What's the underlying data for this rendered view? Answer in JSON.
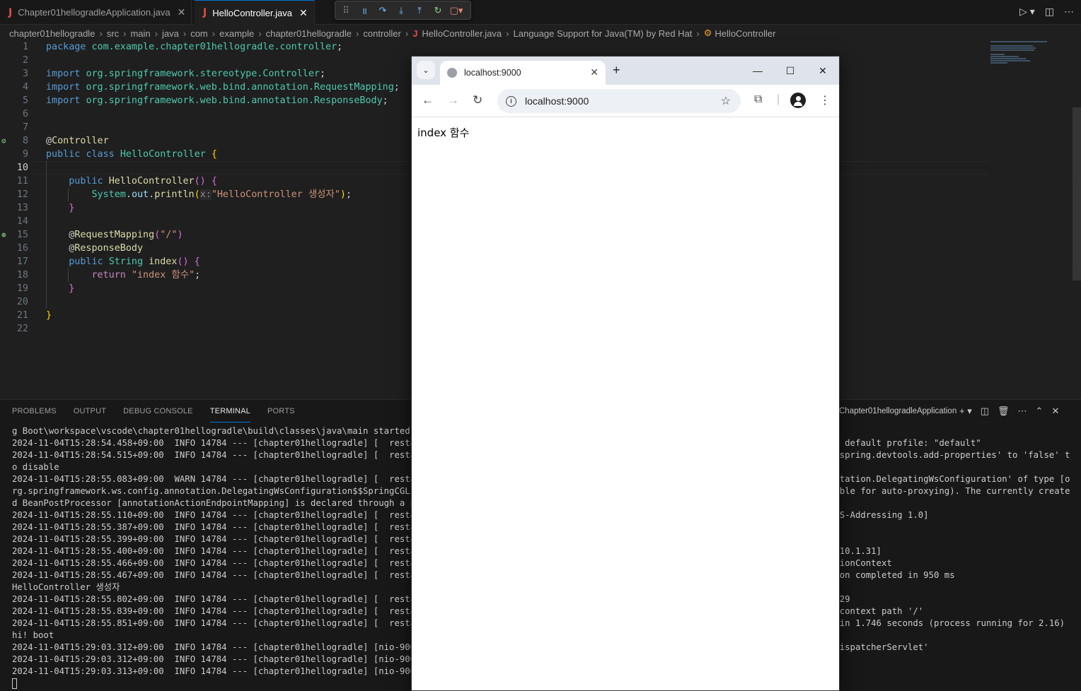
{
  "tabs": [
    {
      "label": "Chapter01hellogradleApplication.java",
      "active": false
    },
    {
      "label": "HelloController.java",
      "active": true
    }
  ],
  "breadcrumb": [
    "chapter01hellogradle",
    "src",
    "main",
    "java",
    "com",
    "example",
    "chapter01hellogradle",
    "controller",
    "HelloController.java",
    "Language Support for Java(TM) by Red Hat",
    "HelloController"
  ],
  "editor": {
    "current_line": 10,
    "line_numbers": [
      "1",
      "2",
      "3",
      "4",
      "5",
      "6",
      "7",
      "8",
      "9",
      "10",
      "11",
      "12",
      "13",
      "14",
      "15",
      "16",
      "17",
      "18",
      "19",
      "20",
      "21",
      "22"
    ],
    "tokens": {
      "package_kw": "package",
      "package_name": "com.example.chapter01hellogradle.controller",
      "import_kw": "import",
      "import1": "org.springframework.stereotype.Controller",
      "import2": "org.springframework.web.bind.annotation.RequestMapping",
      "import3": "org.springframework.web.bind.annotation.ResponseBody",
      "ann_controller": "Controller",
      "public_kw": "public",
      "class_kw": "class",
      "class_name": "HelloController",
      "ctor_name": "HelloController",
      "sysout_system": "System",
      "sysout_out": "out",
      "sysout_println": "println",
      "hint_x": "x:",
      "ctor_string": "\"HelloController 생성자\"",
      "ann_requestmapping": "RequestMapping",
      "ann_rm_arg": "\"/\"",
      "ann_responsebody": "ResponseBody",
      "string_type": "String",
      "method_name": "index",
      "return_kw": "return",
      "return_string": "\"index 함수\""
    }
  },
  "panel": {
    "tabs": [
      "PROBLEMS",
      "OUTPUT",
      "DEBUG CONSOLE",
      "TERMINAL",
      "PORTS"
    ],
    "active_tab": "TERMINAL",
    "terminal_name": "Chapter01hellogradleApplication",
    "terminal_lines": [
      "g Boot\\workspace\\vscode\\chapter01hellogradle\\build\\classes\\java\\main started by b",
      "2024-11-04T15:28:54.458+09:00  INFO 14784 --- [chapter01hellogradle] [  restartec                                                                          o 1 default profile: \"default\"",
      "2024-11-04T15:28:54.515+09:00  INFO 14784 --- [chapter01hellogradle] [  restartec                                                                          t 'spring.devtools.add-properties' to 'false' t",
      "o disable",
      "2024-11-04T15:28:55.083+09:00  WARN 14784 --- [chapter01hellogradle] [  restartec                                                                          nnotation.DelegatingWsConfiguration' of type [o",
      "rg.springframework.ws.config.annotation.DelegatingWsConfiguration$$SpringCGLIB$$0                                                                          igible for auto-proxying). The currently create",
      "d BeanPostProcessor [annotationActionEndpointMapping] is declared through a non-s",
      "2024-11-04T15:28:55.110+09:00  INFO 14784 --- [chapter01hellogradle] [  restartec                                                                          , WS-Addressing 1.0]",
      "2024-11-04T15:28:55.387+09:00  INFO 14784 --- [chapter01hellogradle] [  restartec                                                                          tp)",
      "2024-11-04T15:28:55.399+09:00  INFO 14784 --- [chapter01hellogradle] [  restartec",
      "2024-11-04T15:28:55.400+09:00  INFO 14784 --- [chapter01hellogradle] [  restartec                                                                          at/10.1.31]",
      "2024-11-04T15:28:55.466+09:00  INFO 14784 --- [chapter01hellogradle] [  restartec                                                                          cationContext",
      "2024-11-04T15:28:55.467+09:00  INFO 14784 --- [chapter01hellogradle] [  restartec                                                                          ation completed in 950 ms",
      "HelloController 생성자",
      "2024-11-04T15:28:55.802+09:00  INFO 14784 --- [chapter01hellogradle] [  restartec                                                                          35729",
      "2024-11-04T15:28:55.839+09:00  INFO 14784 --- [chapter01hellogradle] [  restartec                                                                          th context path '/'",
      "2024-11-04T15:28:55.851+09:00  INFO 14784 --- [chapter01hellogradle] [  restartec                                                                          on in 1.746 seconds (process running for 2.16)",
      "hi! boot",
      "2024-11-04T15:29:03.312+09:00  INFO 14784 --- [chapter01hellogradle] [nio-9000-ex                                                                           'dispatcherServlet'",
      "2024-11-04T15:29:03.312+09:00  INFO 14784 --- [chapter01hellogradle] [nio-9000-ex                                                                          et'",
      "2024-11-04T15:29:03.313+09:00  INFO 14784 --- [chapter01hellogradle] [nio-9000-ex"
    ]
  },
  "browser": {
    "tab_title": "localhost:9000",
    "address": "localhost:9000",
    "page_text": "index 함수"
  }
}
